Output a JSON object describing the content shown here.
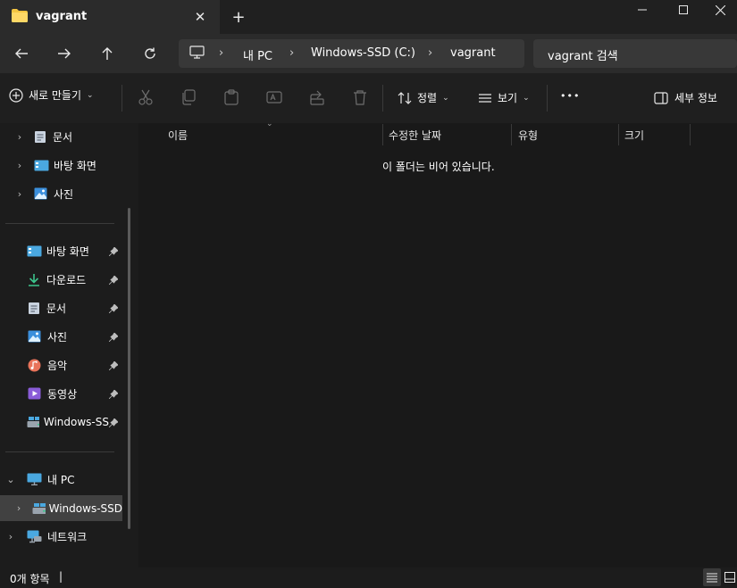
{
  "window": {
    "tab_title": "vagrant",
    "new_tab_symbol": "+",
    "close_symbol": "✕"
  },
  "nav": {
    "breadcrumb": [
      "내 PC",
      "Windows-SSD (C:)",
      "vagrant"
    ],
    "breadcrumb_separator": "›",
    "search_placeholder": "vagrant 검색"
  },
  "commands": {
    "new_label": "새로 만들기",
    "sort_label": "정렬",
    "view_label": "보기",
    "more_label": "•••",
    "details_label": "세부 정보",
    "disabled_icons": [
      "cut-icon",
      "copy-icon",
      "paste-icon",
      "rename-icon",
      "share-icon",
      "delete-icon"
    ]
  },
  "sidebar": {
    "top_items": [
      {
        "label": "문서",
        "icon": "document-icon"
      },
      {
        "label": "바탕 화면",
        "icon": "desktop-icon"
      },
      {
        "label": "사진",
        "icon": "pictures-icon"
      }
    ],
    "quick_access": [
      {
        "label": "바탕 화면",
        "icon": "desktop-icon"
      },
      {
        "label": "다운로드",
        "icon": "download-icon"
      },
      {
        "label": "문서",
        "icon": "document-icon"
      },
      {
        "label": "사진",
        "icon": "pictures-icon"
      },
      {
        "label": "음악",
        "icon": "music-icon"
      },
      {
        "label": "동영상",
        "icon": "video-icon"
      },
      {
        "label": "Windows-SS",
        "icon": "drive-icon"
      }
    ],
    "this_pc": {
      "label": "내 PC",
      "icon": "computer-icon"
    },
    "drive": {
      "label": "Windows-SSD",
      "icon": "drive-icon"
    },
    "network": {
      "label": "네트워크",
      "icon": "network-icon"
    }
  },
  "content": {
    "columns": [
      "이름",
      "수정한 날짜",
      "유형",
      "크기"
    ],
    "empty_message": "이 폴더는 비어 있습니다."
  },
  "status": {
    "item_count": "0개 항목",
    "separator": "|"
  },
  "colors": {
    "accent": "#4cc2ff",
    "folder": "#f4c542",
    "background": "#191919"
  }
}
